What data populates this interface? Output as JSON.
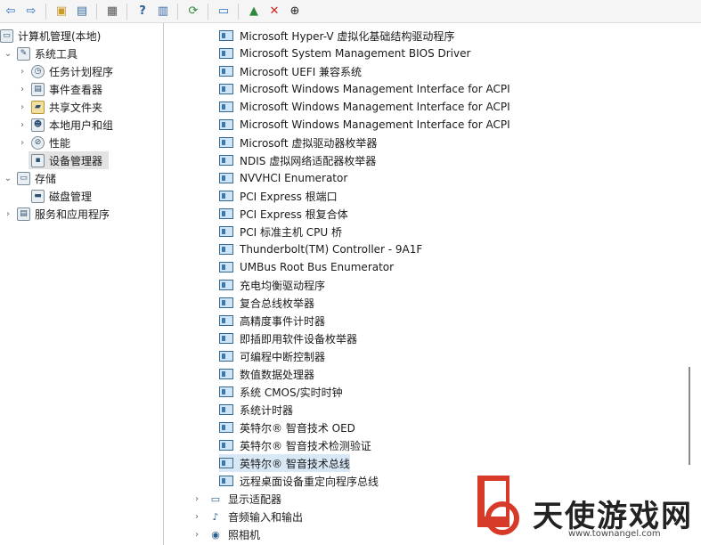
{
  "tree": {
    "root": "计算机管理(本地)",
    "items": [
      {
        "label": "系统工具",
        "icon": "tools-icon"
      },
      {
        "label": "任务计划程序",
        "icon": "clock-icon"
      },
      {
        "label": "事件查看器",
        "icon": "event-viewer-icon"
      },
      {
        "label": "共享文件夹",
        "icon": "shared-folder-icon"
      },
      {
        "label": "本地用户和组",
        "icon": "users-icon"
      },
      {
        "label": "性能",
        "icon": "performance-icon"
      },
      {
        "label": "设备管理器",
        "icon": "device-manager-icon"
      },
      {
        "label": "存储",
        "icon": "storage-icon"
      },
      {
        "label": "磁盘管理",
        "icon": "disk-icon"
      },
      {
        "label": "服务和应用程序",
        "icon": "services-icon"
      }
    ]
  },
  "devices": [
    "Microsoft Hyper-V 虚拟化基础结构驱动程序",
    "Microsoft System Management BIOS Driver",
    "Microsoft UEFI 兼容系统",
    "Microsoft Windows Management Interface for ACPI",
    "Microsoft Windows Management Interface for ACPI",
    "Microsoft Windows Management Interface for ACPI",
    "Microsoft 虚拟驱动器枚举器",
    "NDIS 虚拟网络适配器枚举器",
    "NVVHCI Enumerator",
    "PCI Express 根端口",
    "PCI Express 根复合体",
    "PCI 标准主机 CPU 桥",
    "Thunderbolt(TM) Controller - 9A1F",
    "UMBus Root Bus Enumerator",
    "充电均衡驱动程序",
    "复合总线枚举器",
    "高精度事件计时器",
    "即插即用软件设备枚举器",
    "可编程中断控制器",
    "数值数据处理器",
    "系统 CMOS/实时时钟",
    "系统计时器",
    "英特尔® 智音技术 OED",
    "英特尔® 智音技术检测验证",
    "英特尔® 智音技术总线",
    "远程桌面设备重定向程序总线"
  ],
  "categories": [
    {
      "label": "显示适配器",
      "icon": "display-adapter-icon"
    },
    {
      "label": "音频输入和输出",
      "icon": "audio-icon"
    },
    {
      "label": "照相机",
      "icon": "camera-icon"
    }
  ],
  "watermark": {
    "text": "天使游戏网",
    "url": "www.townangel.com"
  }
}
